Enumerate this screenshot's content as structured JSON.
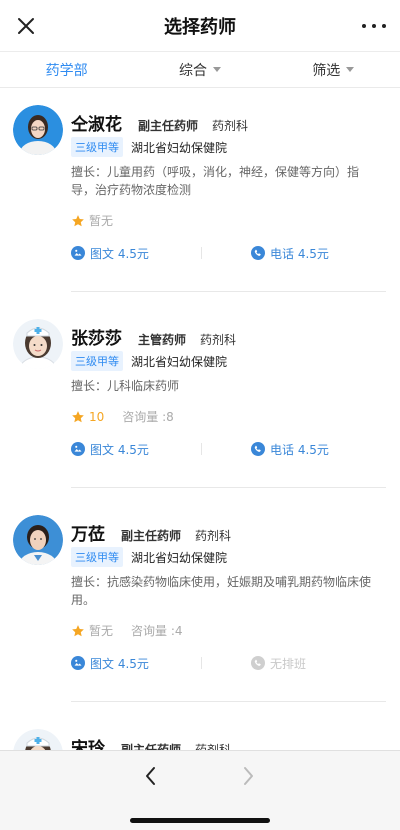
{
  "header": {
    "title": "选择药师",
    "close_icon": "close-icon",
    "more_icon": "more-icon"
  },
  "filter": {
    "tabs": [
      {
        "label": "药学部"
      },
      {
        "label": "综合"
      },
      {
        "label": "筛选"
      }
    ]
  },
  "colors": {
    "accent": "#2f8bf1",
    "star": "#f5a623",
    "service": "#3a87d8"
  },
  "pharmacists": [
    {
      "name": "仝淑花",
      "title": "副主任药师",
      "dept": "药剂科",
      "grade": "三级甲等",
      "hospital": "湖北省妇幼保健院",
      "skill": "擅长：儿童用药（呼吸，消化，神经，保健等方向）指导，治疗药物浓度检测",
      "score": "暂无",
      "consult": "",
      "service_text": "图文 4.5元",
      "service_phone": "电话 4.5元"
    },
    {
      "name": "张莎莎",
      "title": "主管药师",
      "dept": "药剂科",
      "grade": "三级甲等",
      "hospital": "湖北省妇幼保健院",
      "skill": "擅长：儿科临床药师",
      "score": "10",
      "consult": "咨询量 :8",
      "service_text": "图文 4.5元",
      "service_phone": "电话 4.5元"
    },
    {
      "name": "万莅",
      "title": "副主任药师",
      "dept": "药剂科",
      "grade": "三级甲等",
      "hospital": "湖北省妇幼保健院",
      "skill": "擅长：抗感染药物临床使用，妊娠期及哺乳期药物临床使用。",
      "score": "暂无",
      "consult": "咨询量 :4",
      "service_text": "图文 4.5元",
      "service_phone": "无排班"
    },
    {
      "name": "宋玲",
      "title": "副主任药师",
      "dept": "药剂科"
    }
  ],
  "bottom": {
    "back_icon": "chevron-left-icon",
    "forward_icon": "chevron-right-icon"
  }
}
